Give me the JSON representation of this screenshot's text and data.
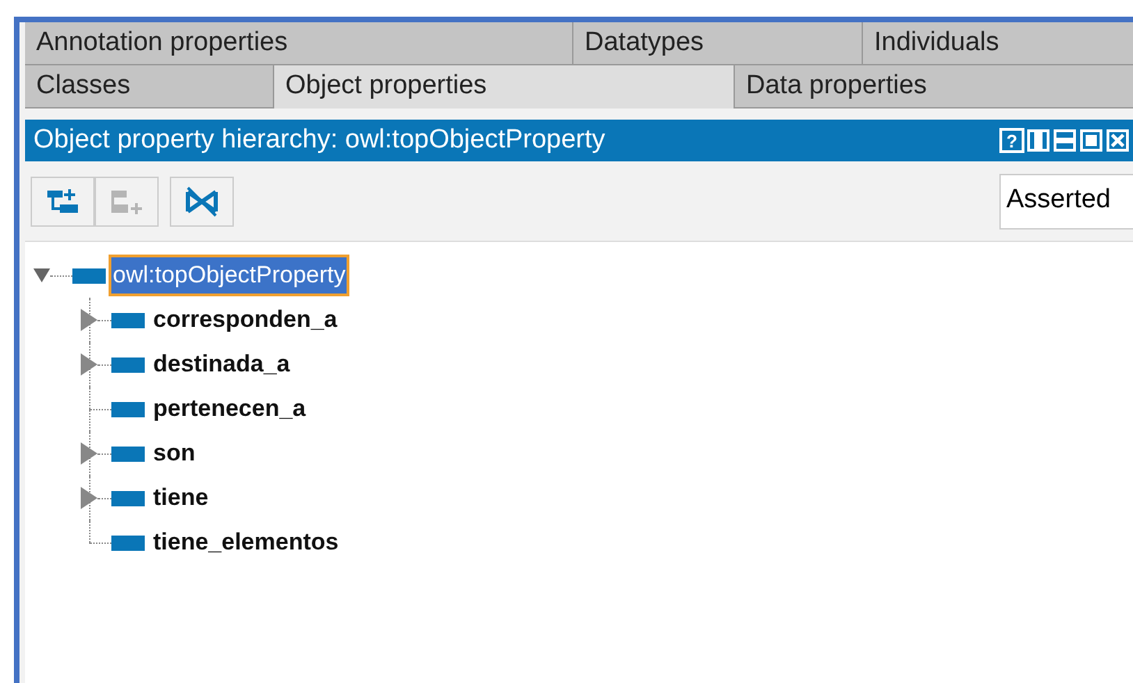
{
  "tab_rows": [
    [
      {
        "label": "Annotation properties",
        "selected": false
      },
      {
        "label": "Datatypes",
        "selected": false
      },
      {
        "label": "Individuals",
        "selected": false
      }
    ],
    [
      {
        "label": "Classes",
        "selected": false
      },
      {
        "label": "Object properties",
        "selected": true
      },
      {
        "label": "Data properties",
        "selected": false
      }
    ]
  ],
  "view": {
    "title": "Object property hierarchy: owl:topObjectProperty",
    "title_buttons": [
      "?"
    ]
  },
  "toolbar": {
    "buttons": [
      {
        "kind": "add-sub",
        "disabled": false
      },
      {
        "kind": "add-sibling",
        "disabled": true
      },
      {
        "kind": "delete",
        "disabled": false
      }
    ],
    "dropdown": {
      "value": "Asserted"
    }
  },
  "tree": [
    {
      "label": "owl:topObjectProperty",
      "selected": true,
      "expanded": true,
      "children": [
        {
          "label": "corresponden_a",
          "selected": false,
          "expandable": true
        },
        {
          "label": "destinada_a",
          "selected": false,
          "expandable": true
        },
        {
          "label": "pertenecen_a",
          "selected": false,
          "expandable": false
        },
        {
          "label": "son",
          "selected": false,
          "expandable": true
        },
        {
          "label": "tiene",
          "selected": false,
          "expandable": true
        },
        {
          "label": "tiene_elementos",
          "selected": false,
          "expandable": false
        }
      ]
    }
  ]
}
